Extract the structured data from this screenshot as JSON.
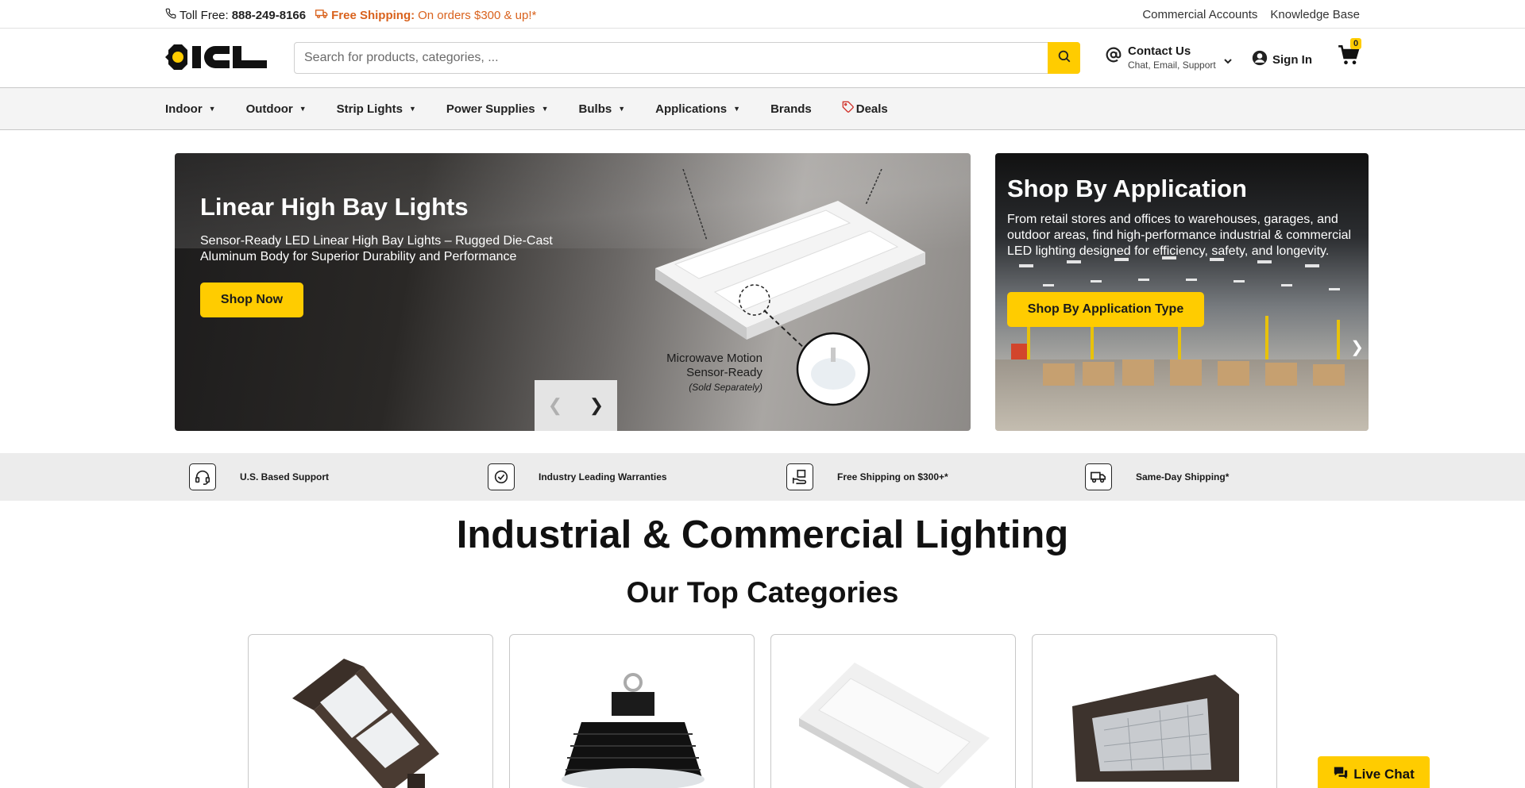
{
  "topbar": {
    "toll_free_label": "Toll Free:",
    "phone": "888-249-8166",
    "free_shipping_label": "Free Shipping:",
    "free_shipping_text": "On orders $300 & up!*",
    "links": [
      "Commercial Accounts",
      "Knowledge Base"
    ]
  },
  "header": {
    "logo_text": "ICL",
    "search_placeholder": "Search for products, categories, ...",
    "contact_title": "Contact Us",
    "contact_sub": "Chat, Email, Support",
    "sign_in": "Sign In",
    "cart_count": "0"
  },
  "nav": {
    "items": [
      "Indoor",
      "Outdoor",
      "Strip Lights",
      "Power Supplies",
      "Bulbs",
      "Applications",
      "Brands",
      "Deals"
    ]
  },
  "hero": {
    "title": "Linear High Bay Lights",
    "subtitle": "Sensor-Ready LED Linear High Bay Lights – Rugged Die-Cast Aluminum Body for Superior Durability and Performance",
    "cta": "Shop Now",
    "sensor_line1": "Microwave Motion",
    "sensor_line2": "Sensor-Ready",
    "sensor_note": "(Sold Separately)"
  },
  "application": {
    "title": "Shop By Application",
    "text": "From retail stores and offices to warehouses, garages, and outdoor areas, find high-performance industrial & commercial LED lighting designed for efficiency, safety, and longevity.",
    "cta": "Shop By Application Type"
  },
  "features": [
    "U.S. Based Support",
    "Industry Leading Warranties",
    "Free Shipping on $300+*",
    "Same-Day Shipping*"
  ],
  "headings": {
    "main": "Industrial & Commercial Lighting",
    "sub": "Our Top Categories"
  },
  "live_chat": "Live Chat",
  "colors": {
    "accent": "#ffcc00",
    "shipping_orange": "#d9621d"
  }
}
